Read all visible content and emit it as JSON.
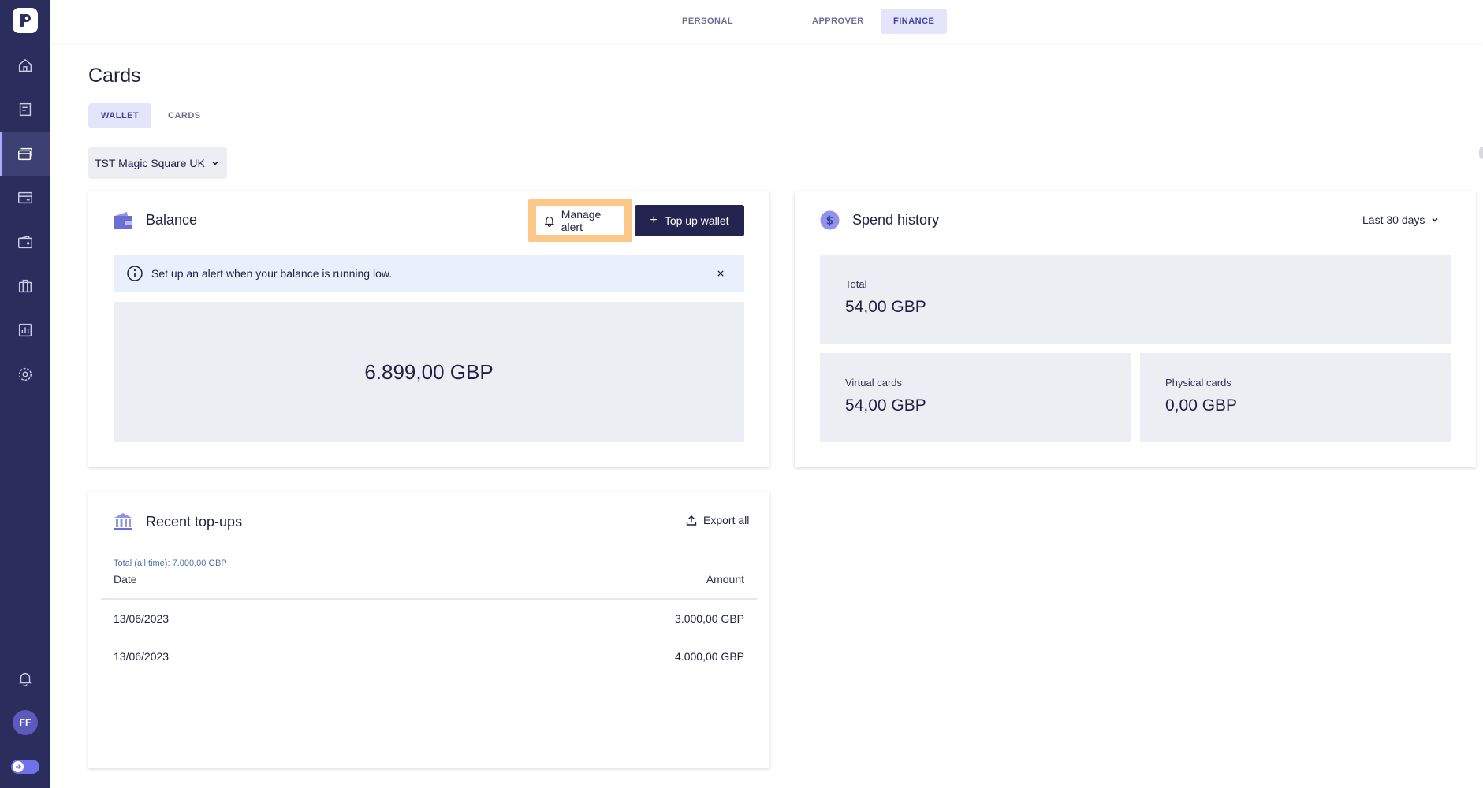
{
  "role_tabs": [
    {
      "label": "PERSONAL",
      "active": false
    },
    {
      "label": "APPROVER",
      "active": false
    },
    {
      "label": "FINANCE",
      "active": true
    }
  ],
  "page": {
    "title": "Cards",
    "sub_tabs": [
      {
        "label": "WALLET",
        "active": true
      },
      {
        "label": "CARDS",
        "active": false
      }
    ],
    "entity_select": {
      "value": "TST Magic Square UK"
    }
  },
  "balance_card": {
    "title": "Balance",
    "manage_alert_label": "Manage alert",
    "top_up_label": "Top up wallet",
    "info_text": "Set up an alert when your balance is running low.",
    "amount": "6.899,00 GBP"
  },
  "spend_history": {
    "title": "Spend history",
    "period": "Last 30 days",
    "total_label": "Total",
    "total_value": "54,00 GBP",
    "virtual_label": "Virtual cards",
    "virtual_value": "54,00 GBP",
    "physical_label": "Physical cards",
    "physical_value": "0,00 GBP"
  },
  "recent_topups": {
    "title": "Recent top-ups",
    "export_label": "Export all",
    "total_note": "Total (all time): 7.000,00 GBP",
    "columns": {
      "date": "Date",
      "amount": "Amount"
    },
    "rows": [
      {
        "date": "13/06/2023",
        "amount": "3.000,00 GBP"
      },
      {
        "date": "13/06/2023",
        "amount": "4.000,00 GBP"
      }
    ]
  },
  "user": {
    "initials": "FF"
  },
  "sidebar": {
    "icons": [
      "home-icon",
      "receipt-icon",
      "cards-icon",
      "card-icon",
      "wallet-icon",
      "briefcase-icon",
      "reports-icon",
      "settings-icon",
      "bell-icon"
    ]
  },
  "colors": {
    "sidebar": "#2b2d5c",
    "primary_button": "#23244f",
    "accent_tab": "#e4e4fb",
    "highlight": "#fbc88a",
    "info_banner": "#e9f0fb"
  }
}
